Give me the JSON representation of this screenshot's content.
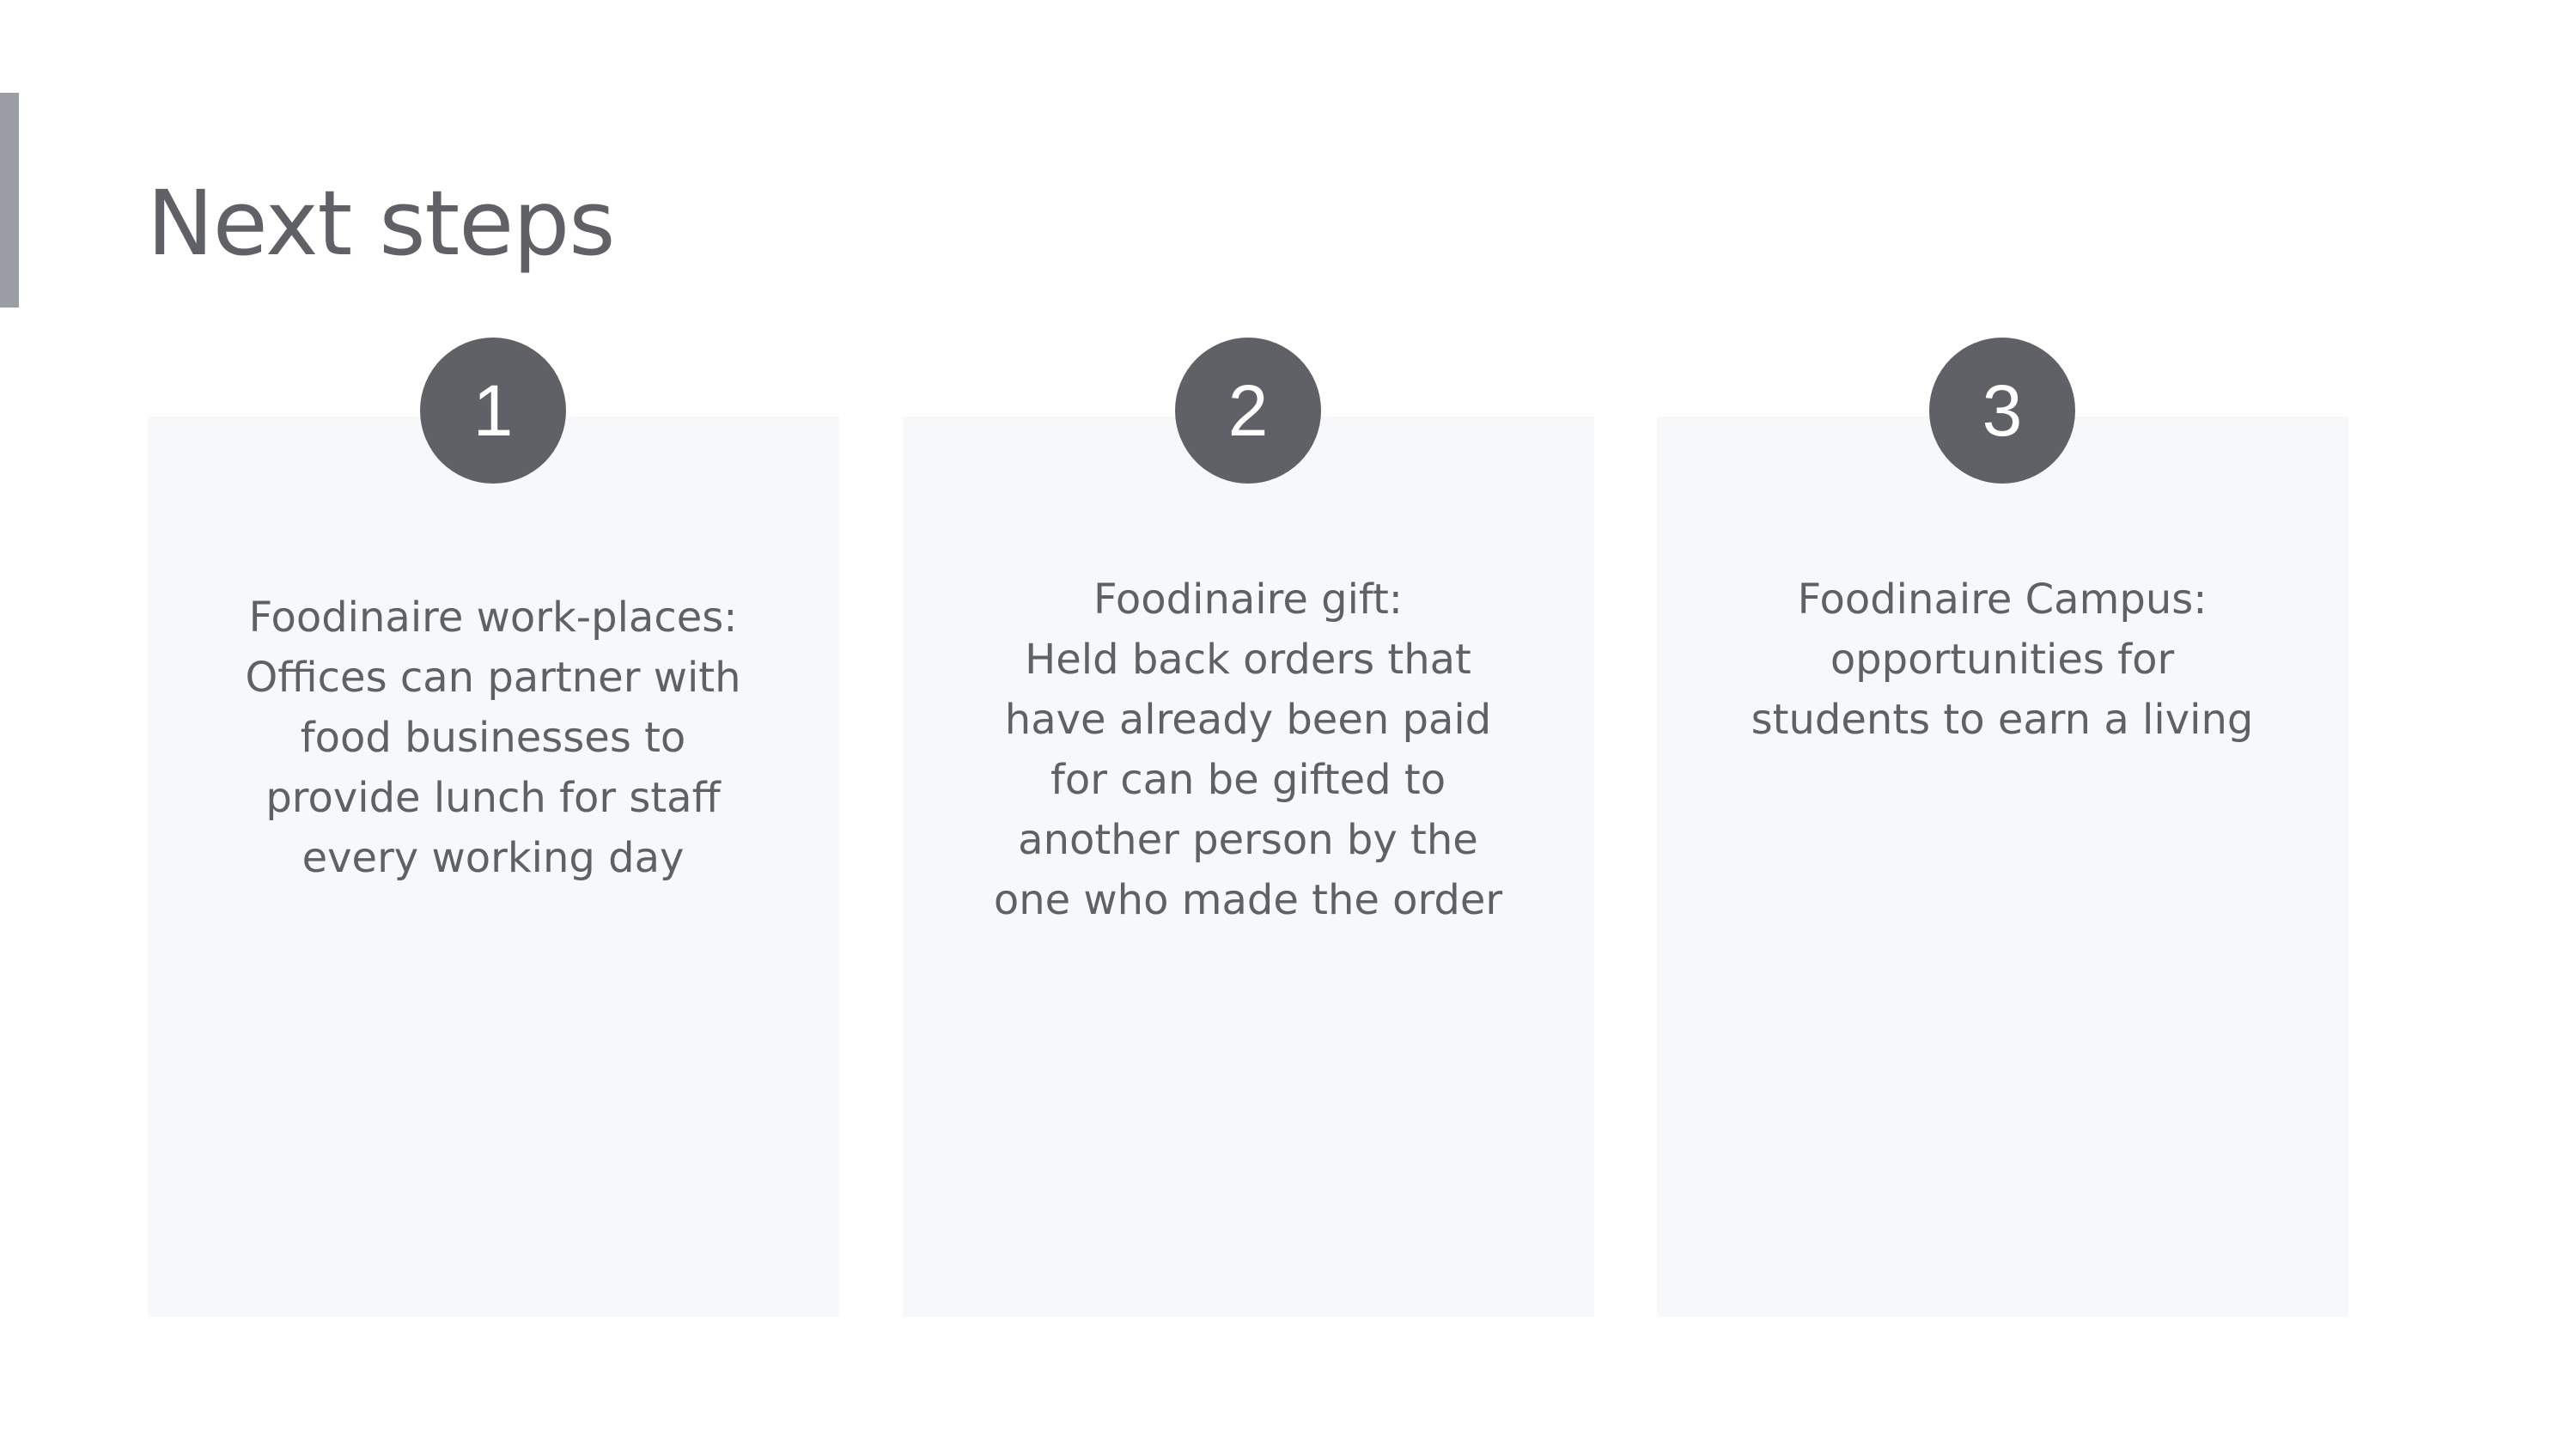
{
  "slide": {
    "title": "Next steps",
    "steps": [
      {
        "number": "1",
        "lines": [
          "Foodinaire work-places:",
          "Offices can partner with",
          "food businesses to",
          "provide lunch for staff",
          "every working day"
        ]
      },
      {
        "number": "2",
        "lines": [
          "Foodinaire gift:",
          "Held back orders that",
          "have already been paid",
          "for can be gifted to",
          "another person by the",
          "one who made the order"
        ]
      },
      {
        "number": "3",
        "lines": [
          "Foodinaire Campus:",
          "opportunities for",
          "students to earn a living"
        ]
      }
    ]
  },
  "colors": {
    "text": "#5f6166",
    "accent_bar": "#9a9da3",
    "card_background": "#f7f8fa",
    "circle_fill": "#5f6166",
    "circle_text": "#ffffff"
  }
}
